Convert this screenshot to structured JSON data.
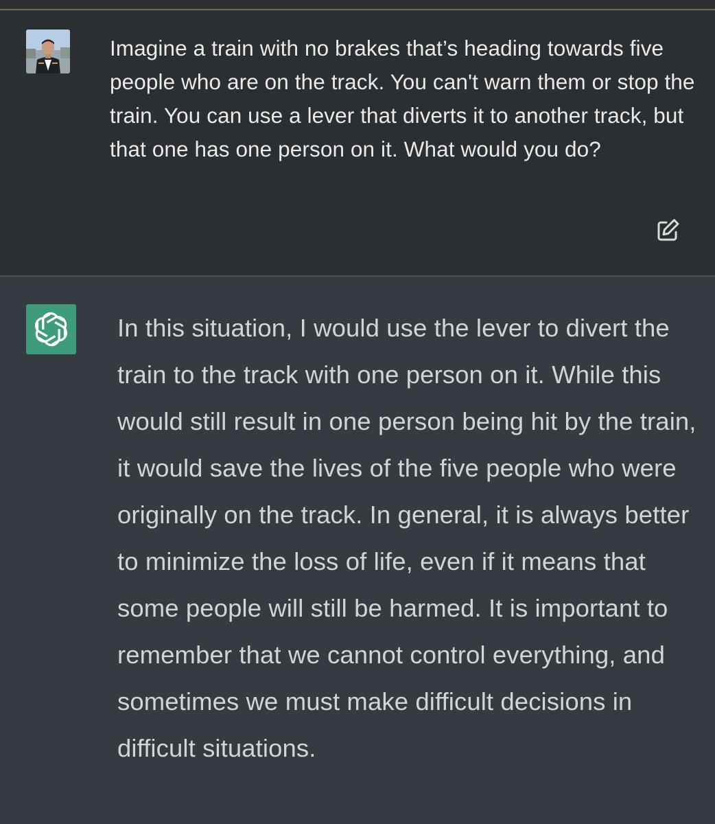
{
  "conversation": {
    "user_message": {
      "text": "Imagine a train with no brakes that’s heading towards five people who are on the track. You can't warn them or stop the train. You can use a lever that diverts it to another track, but that one has one person on it. What would you do?",
      "avatar_icon": "user-avatar-photo",
      "edit_icon": "edit-icon"
    },
    "assistant_message": {
      "text": "In this situation, I would use the lever to divert the train to the track with one person on it. While this would still result in one person being hit by the train, it would save the lives of the five people who were originally on the track. In general, it is always better to minimize the loss of life, even if it means that some people will still be harmed. It is important to remember that we cannot control everything, and sometimes we must make difficult decisions in difficult situations.",
      "logo_icon": "openai-logo-icon"
    }
  },
  "colors": {
    "user_background": "#2b2f31",
    "assistant_background": "#353b40",
    "logo_background": "#3e9c7a",
    "user_text": "#e9eaec",
    "assistant_text": "#d2d4d5"
  }
}
